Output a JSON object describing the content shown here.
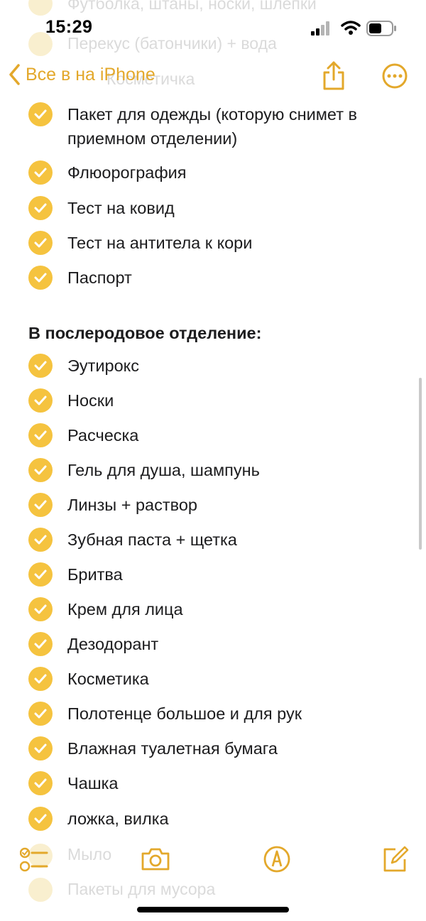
{
  "status": {
    "time": "15:29"
  },
  "nav": {
    "back_label": "Все в на iPhone"
  },
  "faded_top": [
    "Футболка, штаны, носки, шлепки",
    "Перекус (батончики) + вода",
    "Косметичка"
  ],
  "checklist_a": [
    "Пакет для одежды (которую снимет в приемном отделении)",
    "Флюорография",
    "Тест на ковид",
    "Тест на антитела к кори",
    "Паспорт"
  ],
  "section_title": "В послеродовое отделение:",
  "checklist_b": [
    "Эутирокс",
    "Носки",
    "Расческа",
    "Гель для душа, шампунь",
    "Линзы + раствор",
    "Зубная паста + щетка",
    "Бритва",
    "Крем для лица",
    "Дезодорант",
    "Косметика",
    "Полотенце большое и для рук",
    "Влажная туалетная бумага",
    "Чашка",
    "ложка, вилка"
  ],
  "faded_bottom": [
    "Мыло",
    "Пакеты для мусора"
  ],
  "colors": {
    "accent": "#e3a82b",
    "check": "#f5c33f"
  }
}
